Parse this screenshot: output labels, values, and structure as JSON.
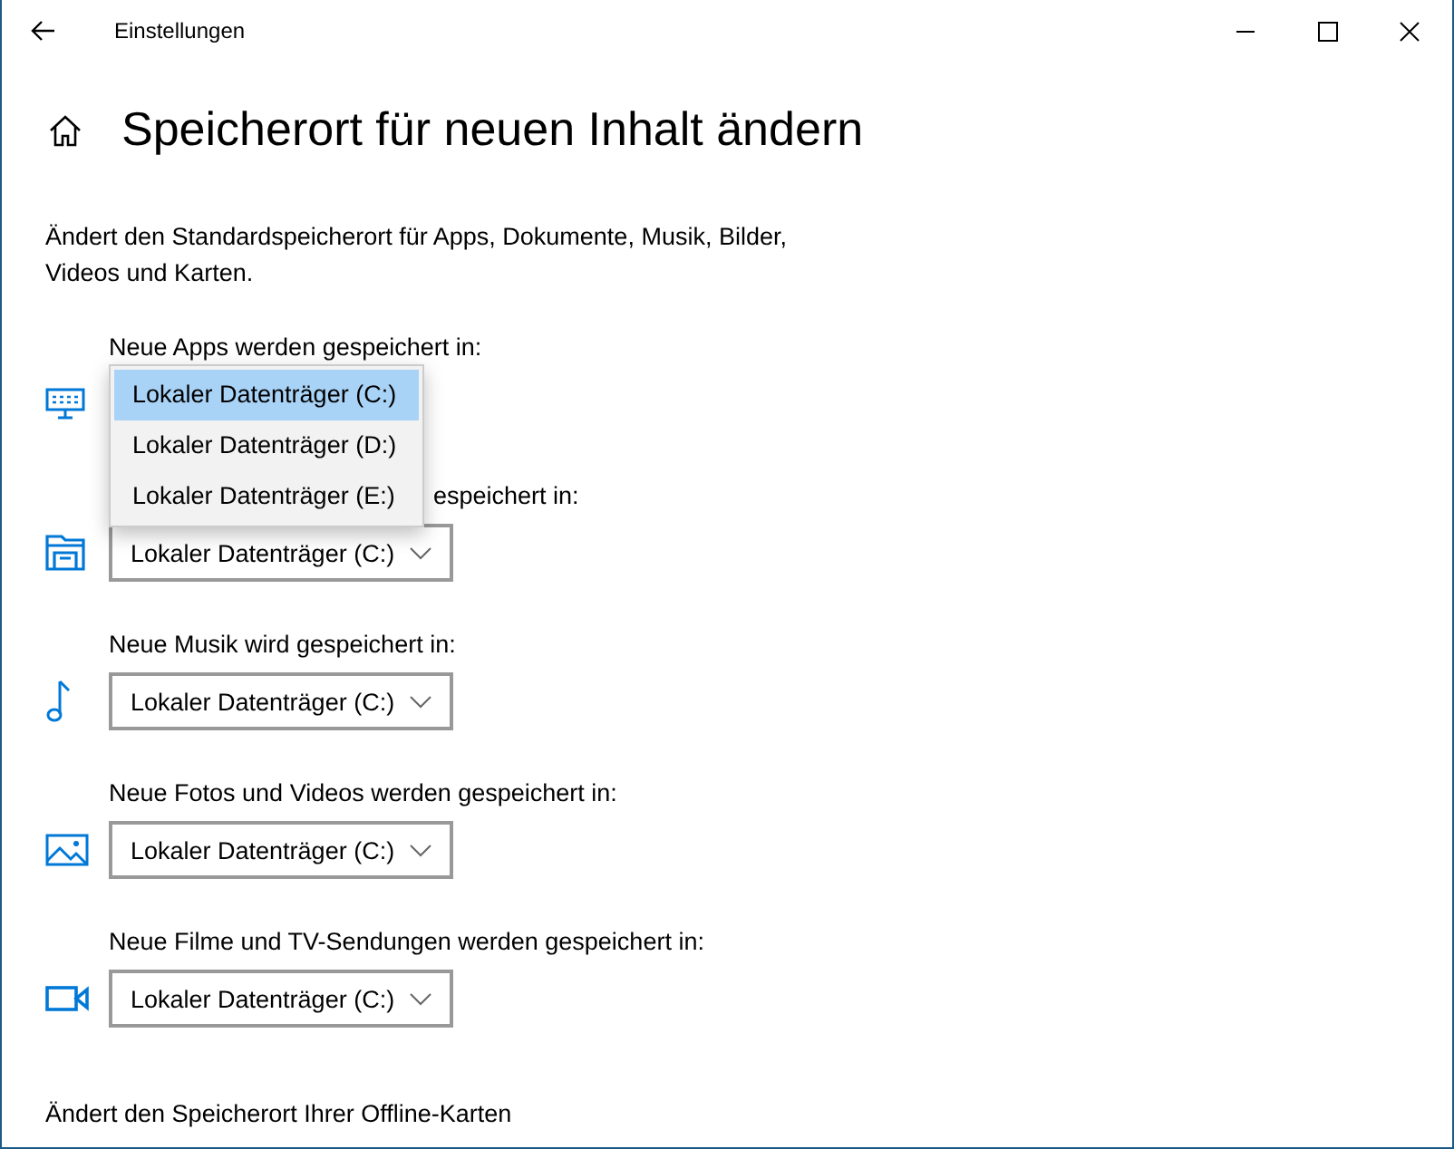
{
  "window": {
    "title": "Einstellungen"
  },
  "page": {
    "title": "Speicherort für neuen Inhalt ändern",
    "description": "Ändert den Standardspeicherort für Apps, Dokumente, Musik, Bilder, Videos und Karten."
  },
  "sections": [
    {
      "label": "Neue Apps werden gespeichert in:",
      "kind": "monitor",
      "dropdown": {
        "expanded": true,
        "options": [
          {
            "label": "Lokaler Datenträger (C:)",
            "selected": true
          },
          {
            "label": "Lokaler Datenträger (D:)",
            "selected": false
          },
          {
            "label": "Lokaler Datenträger (E:)",
            "selected": false
          }
        ]
      }
    },
    {
      "label": "espeichert in:",
      "kind": "folder",
      "dropdown": {
        "expanded": false,
        "value": "Lokaler Datenträger (C:)"
      }
    },
    {
      "label": "Neue Musik wird gespeichert in:",
      "kind": "music",
      "dropdown": {
        "expanded": false,
        "value": "Lokaler Datenträger (C:)"
      }
    },
    {
      "label": "Neue Fotos und Videos werden gespeichert in:",
      "kind": "image",
      "dropdown": {
        "expanded": false,
        "value": "Lokaler Datenträger (C:)"
      }
    },
    {
      "label": "Neue Filme und TV-Sendungen werden gespeichert in:",
      "kind": "video",
      "dropdown": {
        "expanded": false,
        "value": "Lokaler Datenträger (C:)"
      }
    }
  ],
  "footer_text": "Ändert den Speicherort Ihrer Offline-Karten"
}
